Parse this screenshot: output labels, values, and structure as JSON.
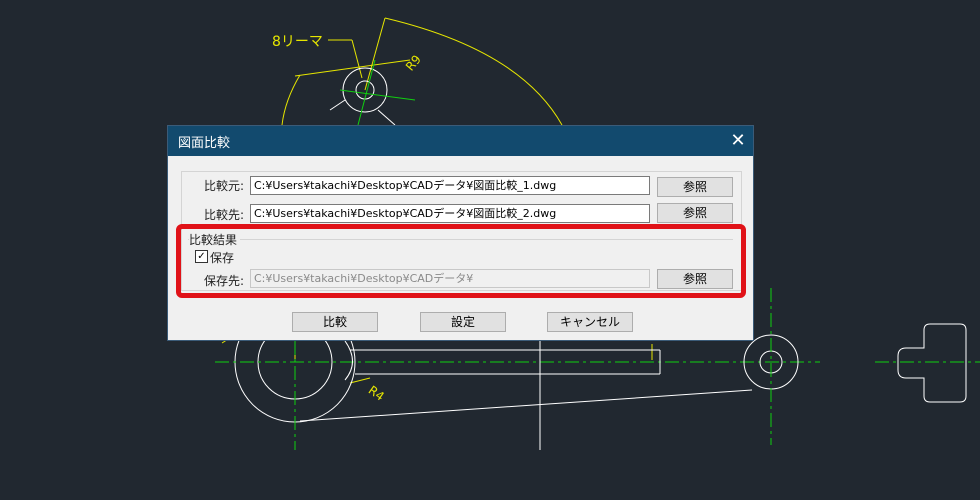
{
  "cad": {
    "annotations": {
      "reamer": "8リーマ",
      "r9": "R9",
      "r4": "R4"
    }
  },
  "dialog": {
    "title": "図面比較",
    "close_glyph": "✕",
    "source_label": "比較元:",
    "source_value": "C:¥Users¥takachi¥Desktop¥CADデータ¥図面比較_1.dwg",
    "target_label": "比較先:",
    "target_value": "C:¥Users¥takachi¥Desktop¥CADデータ¥図面比較_2.dwg",
    "browse_label": "参照",
    "result_group_label": "比較結果",
    "save_checkbox_checked": true,
    "save_checkbox_label": "保存",
    "save_dest_label": "保存先:",
    "save_dest_value": "C:¥Users¥takachi¥Desktop¥CADデータ¥",
    "compare_button": "比較",
    "settings_button": "設定",
    "cancel_button": "キャンセル"
  },
  "colors": {
    "cad_background": "#212830",
    "highlight_border": "#e01218",
    "title_bar": "#124a6e"
  }
}
